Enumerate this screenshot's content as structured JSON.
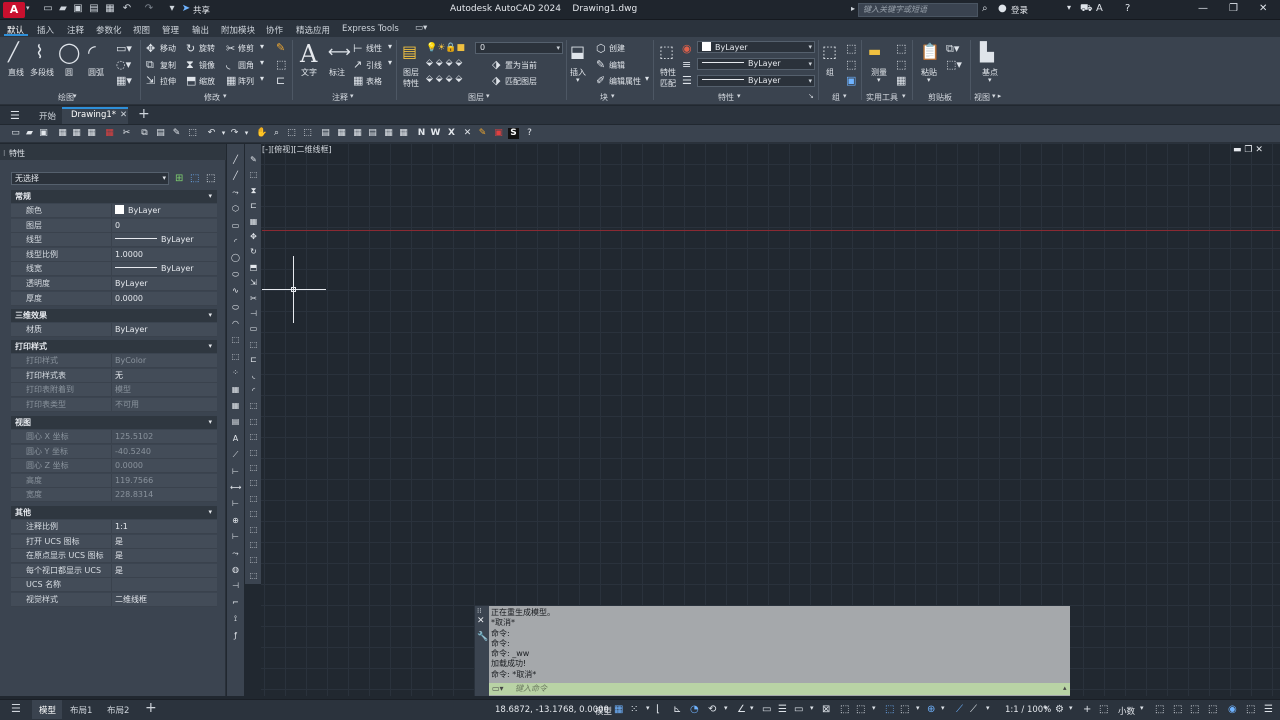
{
  "titlebar": {
    "logo": "A",
    "share_label": "共享",
    "app_title": "Autodesk AutoCAD 2024",
    "file_name": "Drawing1.dwg",
    "search_placeholder": "键入关键字或短语",
    "login_label": "登录"
  },
  "ribbon_tabs": [
    "默认",
    "插入",
    "注释",
    "参数化",
    "视图",
    "管理",
    "输出",
    "附加模块",
    "协作",
    "精选应用",
    "Express Tools"
  ],
  "ribbon": {
    "draw": {
      "label": "绘图",
      "line": "直线",
      "polyline": "多段线",
      "circle": "圆",
      "arc": "圆弧"
    },
    "modify": {
      "label": "修改",
      "move": "移动",
      "rotate": "旋转",
      "trim": "修剪",
      "copy": "复制",
      "mirror": "镜像",
      "fillet": "圆角",
      "stretch": "拉伸",
      "scale": "缩放",
      "array": "阵列"
    },
    "annotation": {
      "label": "注释",
      "text": "文字",
      "dim": "标注",
      "linear": "线性",
      "leader": "引线",
      "table": "表格"
    },
    "layers": {
      "label": "图层",
      "layer_props_l1": "图层",
      "layer_props_l2": "特性",
      "layer_value": "0",
      "make_current": "置为当前",
      "match_layer": "匹配图层"
    },
    "block": {
      "label": "块",
      "insert": "插入",
      "create": "创建",
      "edit": "编辑",
      "edit_attr": "编辑属性"
    },
    "properties": {
      "label": "特性",
      "match_l1": "特性",
      "match_l2": "匹配",
      "color": "ByLayer",
      "linetype": "ByLayer",
      "lineweight": "ByLayer"
    },
    "groups": {
      "label": "组",
      "group": "组"
    },
    "utilities": {
      "label": "实用工具",
      "measure": "测量"
    },
    "clipboard": {
      "label": "剪贴板",
      "paste": "粘贴"
    },
    "view": {
      "label": "视图",
      "base": "基点"
    }
  },
  "filetabs": {
    "start": "开始",
    "drawing": "Drawing1*"
  },
  "properties_palette": {
    "title": "特性",
    "selection": "无选择",
    "sections": {
      "general": {
        "title": "常规",
        "rows": [
          {
            "name": "颜色",
            "value": "ByLayer"
          },
          {
            "name": "图层",
            "value": "0"
          },
          {
            "name": "线型",
            "value": "ByLayer"
          },
          {
            "name": "线型比例",
            "value": "1.0000"
          },
          {
            "name": "线宽",
            "value": "ByLayer"
          },
          {
            "name": "透明度",
            "value": "ByLayer"
          },
          {
            "name": "厚度",
            "value": "0.0000"
          }
        ]
      },
      "threed": {
        "title": "三维效果",
        "rows": [
          {
            "name": "材质",
            "value": "ByLayer"
          }
        ]
      },
      "plot": {
        "title": "打印样式",
        "rows": [
          {
            "name": "打印样式",
            "value": "ByColor"
          },
          {
            "name": "打印样式表",
            "value": "无"
          },
          {
            "name": "打印表附着到",
            "value": "模型"
          },
          {
            "name": "打印表类型",
            "value": "不可用"
          }
        ]
      },
      "view": {
        "title": "视图",
        "rows": [
          {
            "name": "圆心 X 坐标",
            "value": "125.5102"
          },
          {
            "name": "圆心 Y 坐标",
            "value": "-40.5240"
          },
          {
            "name": "圆心 Z 坐标",
            "value": "0.0000"
          },
          {
            "name": "高度",
            "value": "119.7566"
          },
          {
            "name": "宽度",
            "value": "228.8314"
          }
        ]
      },
      "misc": {
        "title": "其他",
        "rows": [
          {
            "name": "注释比例",
            "value": "1:1"
          },
          {
            "name": "打开 UCS 图标",
            "value": "是"
          },
          {
            "name": "在原点显示 UCS 图标",
            "value": "是"
          },
          {
            "name": "每个视口都显示 UCS",
            "value": "是"
          },
          {
            "name": "UCS 名称",
            "value": ""
          },
          {
            "name": "视觉样式",
            "value": "二维线框"
          }
        ]
      }
    }
  },
  "viewport_label": "[-][俯视][二维线框]",
  "command_window": {
    "lines": [
      "正在重生成模型。",
      "*取消*",
      "命令:",
      "命令:",
      "命令: _ww",
      "加载成功!",
      "命令: *取消*"
    ],
    "input_placeholder": "键入命令"
  },
  "statusbar": {
    "tabs": [
      "模型",
      "布局1",
      "布局2"
    ],
    "coords": "18.6872, -13.1768, 0.0000",
    "model_label": "模型",
    "scale": "1:1 / 100%",
    "units": "小数"
  }
}
